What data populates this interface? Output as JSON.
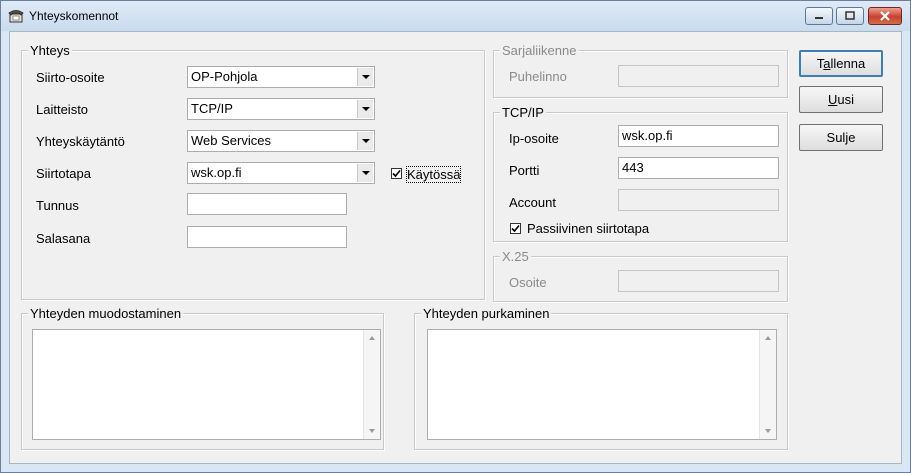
{
  "window": {
    "title": "Yhteyskomennot",
    "icon": "telephone-icon"
  },
  "yhteys": {
    "legend": "Yhteys",
    "siirto_osoite": {
      "label": "Siirto-osoite",
      "value": "OP-Pohjola"
    },
    "laitteisto": {
      "label": "Laitteisto",
      "value": "TCP/IP"
    },
    "yhteyskaytanto": {
      "label": "Yhteyskäytäntö",
      "value": "Web Services"
    },
    "siirtotapa": {
      "label": "Siirtotapa",
      "value": "wsk.op.fi"
    },
    "kaytossa": {
      "label": "Käytössä",
      "checked": true
    },
    "tunnus": {
      "label": "Tunnus",
      "value": ""
    },
    "salasana": {
      "label": "Salasana",
      "value": ""
    }
  },
  "sarjaliikenne": {
    "legend": "Sarjaliikenne",
    "puhelinno_label": "Puhelinno",
    "puhelinno_value": ""
  },
  "tcpip": {
    "legend": "TCP/IP",
    "ip_label": "Ip-osoite",
    "ip_value": "wsk.op.fi",
    "portti_label": "Portti",
    "portti_value": "443",
    "account_label": "Account",
    "account_value": "",
    "passive_label": "Passiivinen siirtotapa",
    "passive_checked": true
  },
  "x25": {
    "legend": "X.25",
    "osoite_label": "Osoite",
    "osoite_value": ""
  },
  "muodostaminen": {
    "legend": "Yhteyden muodostaminen",
    "text": ""
  },
  "purkaminen": {
    "legend": "Yhteyden purkaminen",
    "text": ""
  },
  "buttons": {
    "tallenna_pre": "T",
    "tallenna_acc": "a",
    "tallenna_post": "llenna",
    "uusi_acc": "U",
    "uusi_post": "usi",
    "sulje": "Sulje"
  },
  "colors": {
    "accent": "#3c7fb1",
    "close_button": "#c7412b",
    "title_bar": "#c9dbee"
  }
}
